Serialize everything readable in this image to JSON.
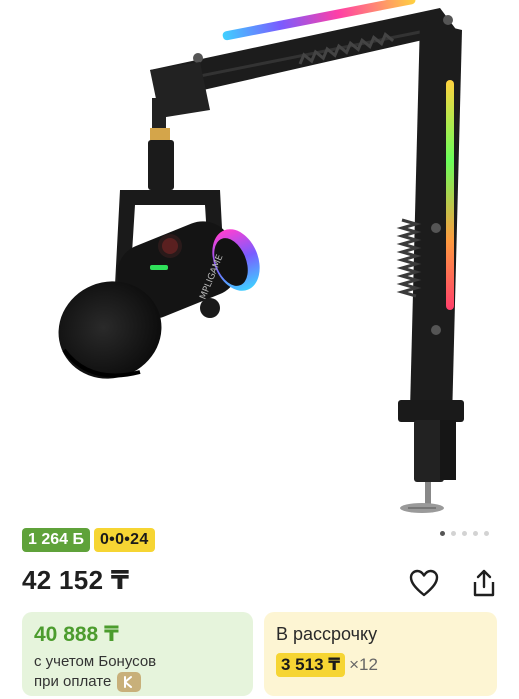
{
  "product": {
    "image_alt_icon": "microphone-boom-arm-image",
    "gallery": {
      "count": 5,
      "active": 1
    }
  },
  "badges": {
    "bonus": "1 264 Б",
    "installment": "0•0•24"
  },
  "price": {
    "main": "42 152 ₸"
  },
  "actions": {
    "favorite_icon": "heart-icon",
    "share_icon": "share-icon"
  },
  "bonus_card": {
    "price": "40 888 ₸",
    "note_line1": "с учетом Бонусов",
    "note_line2": "при оплате"
  },
  "installment_card": {
    "title": "В рассрочку",
    "amount": "3 513 ₸",
    "months": "×12"
  },
  "colors": {
    "bonus_green": "#5fa23a",
    "installment_yellow": "#f6d533",
    "bonus_card_bg": "#e6f4dc",
    "installment_card_bg": "#fdf5d3"
  }
}
